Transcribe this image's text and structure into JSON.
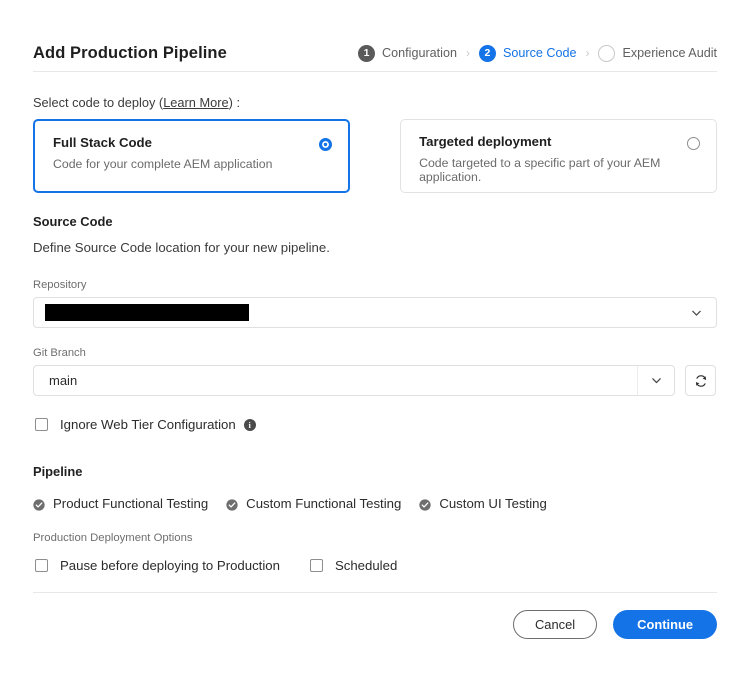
{
  "header": {
    "title": "Add Production Pipeline",
    "stepper": {
      "separator": "›",
      "steps": [
        {
          "number": "1",
          "label": "Configuration",
          "state": "done"
        },
        {
          "number": "2",
          "label": "Source Code",
          "state": "current"
        },
        {
          "number": "",
          "label": "Experience Audit",
          "state": "todo"
        }
      ]
    }
  },
  "deploy": {
    "label_before": "Select code to deploy (",
    "link": "Learn More",
    "label_after": ") :",
    "cards": [
      {
        "title": "Full Stack Code",
        "desc": "Code for your complete AEM application",
        "selected": true
      },
      {
        "title": "Targeted deployment",
        "desc": "Code targeted to a specific part of your AEM application.",
        "selected": false
      }
    ]
  },
  "source_code": {
    "heading": "Source Code",
    "subtext": "Define Source Code location for your new pipeline.",
    "repository": {
      "label": "Repository",
      "value": "",
      "redacted": true
    },
    "git_branch": {
      "label": "Git Branch",
      "value": "main"
    },
    "ignore_web_tier": {
      "label": "Ignore Web Tier Configuration",
      "checked": false,
      "info": "i"
    }
  },
  "pipeline": {
    "heading": "Pipeline",
    "items": [
      {
        "label": "Product Functional Testing",
        "checked": true
      },
      {
        "label": "Custom Functional Testing",
        "checked": true
      },
      {
        "label": "Custom UI Testing",
        "checked": true
      }
    ]
  },
  "production_deployment": {
    "label": "Production Deployment Options",
    "options": [
      {
        "label": "Pause before deploying to Production",
        "checked": false
      },
      {
        "label": "Scheduled",
        "checked": false
      }
    ]
  },
  "footer": {
    "cancel_label": "Cancel",
    "continue_label": "Continue"
  },
  "colors": {
    "accent_blue": "#1473e6",
    "step_done_gray": "#5a5a5a",
    "text_primary": "#2c2c2c",
    "text_secondary": "#6e6e6e",
    "border": "#e0e0e0"
  }
}
